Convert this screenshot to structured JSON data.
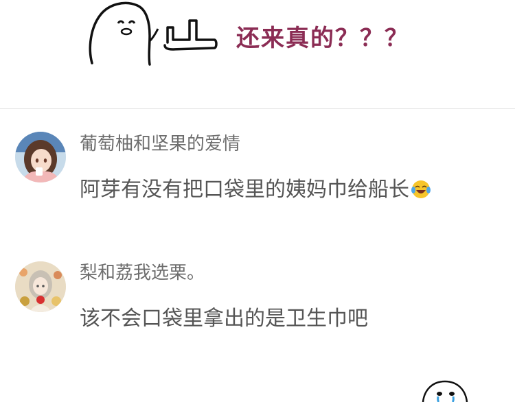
{
  "header": {
    "meme_caption": "还来真的？？？",
    "meme_image": "ghost-pointing-meme",
    "caption_color": "#8b2c54"
  },
  "comments": [
    {
      "username": "葡萄柚和坚果的爱情",
      "avatar": "anime-girl-avatar",
      "text": "阿芽有没有把口袋里的姨妈巾给船长",
      "emoji": "laughing-crying-emoji"
    },
    {
      "username": "梨和荔我选栗。",
      "avatar": "flower-girl-avatar",
      "text": "该不会口袋里拿出的是卫生巾吧"
    }
  ],
  "footer": {
    "meme_image": "crying-face-meme"
  }
}
